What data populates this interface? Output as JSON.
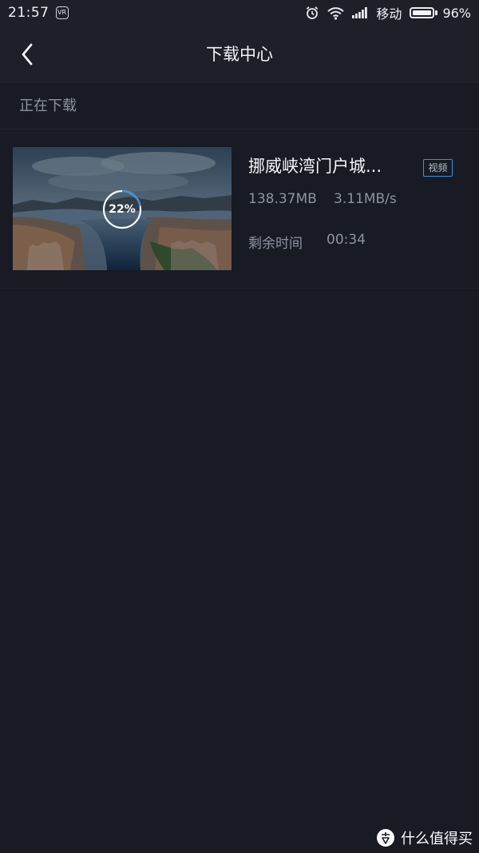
{
  "status_bar": {
    "time": "21:57",
    "vr_badge": "VR",
    "carrier": "移动",
    "battery_percent": "96%",
    "battery_level": 0.96,
    "icons": [
      "alarm-icon",
      "wifi-icon",
      "signal-icon",
      "battery-icon"
    ]
  },
  "header": {
    "title": "下载中心",
    "back_icon": "chevron-left-icon"
  },
  "section": {
    "label": "正在下载"
  },
  "downloads": [
    {
      "title": "挪威峡湾门户城...",
      "type_badge": "视频",
      "size": "138.37MB",
      "speed": "3.11MB/s",
      "remaining_label": "剩余时间",
      "remaining_time": "00:34",
      "progress_percent": "22%",
      "progress_fraction": 0.22
    }
  ],
  "colors": {
    "background": "#181b23",
    "header": "#1d2029",
    "accent": "#3b8fe3",
    "text_primary": "#f3f4f7",
    "text_secondary": "#8d93a3"
  },
  "watermark": {
    "text": "什么值得买"
  }
}
